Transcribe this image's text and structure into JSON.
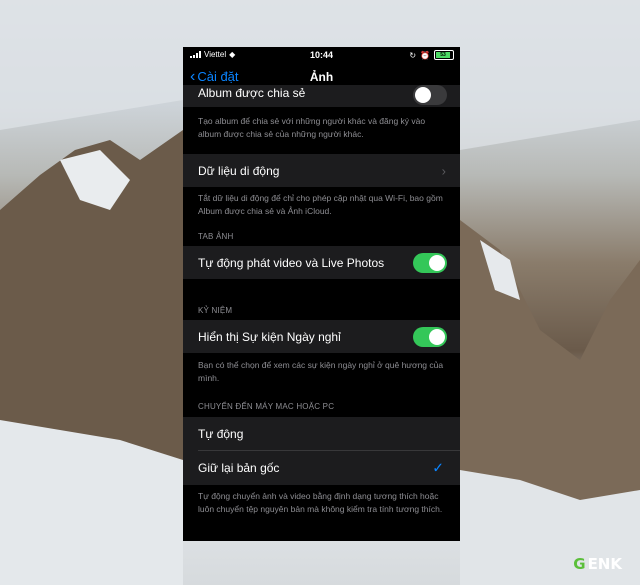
{
  "status_bar": {
    "carrier": "Viettel",
    "time": "10:44",
    "battery_percent_label": "53"
  },
  "nav": {
    "back_label": "Cài đặt",
    "title": "Ảnh"
  },
  "sections": {
    "shared_album": {
      "label": "Album được chia sẻ",
      "toggle_on": false,
      "footer": "Tạo album để chia sẻ với những người khác và đăng ký vào album được chia sẻ của những người khác."
    },
    "cellular": {
      "label": "Dữ liệu di động",
      "footer": "Tắt dữ liệu di động để chỉ cho phép cập nhật qua Wi-Fi, bao gồm Album được chia sẻ và Ảnh iCloud."
    },
    "photos_tab": {
      "header": "TAB ẢNH",
      "autoplay_label": "Tự động phát video và Live Photos",
      "autoplay_on": true
    },
    "memories": {
      "header": "KỶ NIỆM",
      "holiday_label": "Hiển thị Sự kiện Ngày nghỉ",
      "holiday_on": true,
      "footer": "Bạn có thể chọn để xem các sự kiện ngày nghỉ ở quê hương của mình."
    },
    "transfer": {
      "header": "CHUYỂN ĐẾN MÁY MAC HOẶC PC",
      "options": [
        "Tự động",
        "Giữ lại bản gốc"
      ],
      "selected": "Giữ lại bản gốc",
      "footer": "Tự động chuyển ảnh và video bằng định dạng tương thích hoặc luôn chuyển tệp nguyên bản mà không kiểm tra tính tương thích."
    }
  },
  "watermark": {
    "g": "G",
    "rest": "ENK"
  },
  "colors": {
    "accent": "#0a84ff",
    "toggle_on": "#34c759",
    "cell_bg": "#1c1c1e"
  }
}
